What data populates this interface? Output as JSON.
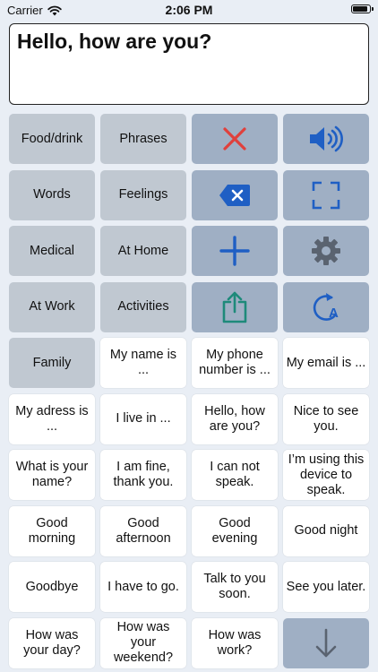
{
  "status_bar": {
    "carrier": "Carrier",
    "time": "2:06 PM",
    "battery_level": 0.95
  },
  "message": {
    "text": "Hello, how are you?"
  },
  "colors": {
    "red_x": "#e0403c",
    "blue": "#1f5fc4",
    "teal": "#1e8a7a",
    "gray": "#5a6370"
  },
  "categories": {
    "food_drink": "Food/drink",
    "phrases": "Phrases",
    "words": "Words",
    "feelings": "Feelings",
    "medical": "Medical",
    "at_home": "At Home",
    "at_work": "At Work",
    "activities": "Activities",
    "family": "Family"
  },
  "controls": {
    "clear": "close-icon",
    "speak": "speaker-icon",
    "backspace": "backspace-icon",
    "fullscreen": "fullscreen-icon",
    "add": "plus-icon",
    "settings": "gear-icon",
    "share": "share-icon",
    "voice": "voice-accent-icon",
    "scroll_down": "arrow-down-icon"
  },
  "phrases": {
    "my_name": "My name is ...",
    "my_phone": "My phone number is ...",
    "my_email": "My email is ...",
    "my_address": "My adress is ...",
    "i_live_in": "I live in ...",
    "hello_how": "Hello, how are you?",
    "nice_to_see": "Nice to see you.",
    "what_is_name": "What is your name?",
    "i_am_fine": "I am fine, thank you.",
    "can_not_speak": "I can not speak.",
    "using_device": "I’m using this device to speak.",
    "good_morning": "Good morning",
    "good_afternoon": "Good afternoon",
    "good_evening": "Good evening",
    "good_night": "Good night",
    "goodbye": "Goodbye",
    "have_to_go": "I have to go.",
    "talk_soon": "Talk to you soon.",
    "see_you_later": "See you later.",
    "how_was_day": "How was your day?",
    "how_was_weekend": "How was your weekend?",
    "how_was_work": "How was work?"
  }
}
